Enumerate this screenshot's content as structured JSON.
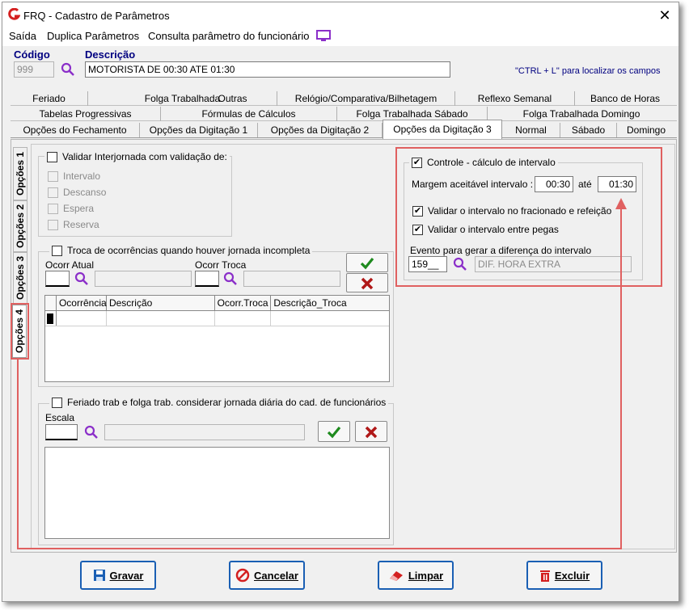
{
  "window": {
    "title": "FRQ - Cadastro de Parâmetros",
    "close": "✕"
  },
  "menu": [
    "Saída",
    "Duplica Parâmetros",
    "Consulta parâmetro do funcionário"
  ],
  "header": {
    "codigo_label": "Código",
    "codigo_value": "999",
    "descricao_label": "Descrição",
    "descricao_value": "MOTORISTA DE 00:30 ATE 01:30",
    "hint": "\"CTRL + L\" para localizar os campos"
  },
  "tabs_row1": [
    "Feriado",
    "Folga Trabalhada",
    "Outras",
    "Relógio/Comparativa/Bilhetagem",
    "Reflexo Semanal",
    "Banco de Horas"
  ],
  "tabs_row2": [
    "Tabelas Progressivas",
    "Fórmulas de Cálculos",
    "Folga Trabalhada Sábado",
    "Folga Trabalhada Domingo"
  ],
  "tabs_row3": [
    "Opções do Fechamento",
    "Opções da Digitação 1",
    "Opções da Digitação 2",
    "Opções da Digitação 3",
    "Normal",
    "Sábado",
    "Domingo"
  ],
  "side_tabs": [
    "Opções 1",
    "Opções 2",
    "Opções 3",
    "Opções 4"
  ],
  "interjornada": {
    "label": "Validar Interjornada com validação de:",
    "options": [
      "Intervalo",
      "Descanso",
      "Espera",
      "Reserva"
    ]
  },
  "troca": {
    "label": "Troca de ocorrências quando houver jornada incompleta",
    "ocorr_atual": "Ocorr Atual",
    "ocorr_troca": "Ocorr Troca",
    "columns": [
      "Ocorrência",
      "Descrição",
      "Ocorr.Troca",
      "Descrição_Troca"
    ]
  },
  "feriado": {
    "label": "Feriado trab e folga trab. considerar jornada diária do cad. de funcionários",
    "escala": "Escala"
  },
  "controle": {
    "label": "Controle - cálculo de intervalo",
    "margem_label": "Margem aceitável intervalo :",
    "from": "00:30",
    "ate": "até",
    "to": "01:30",
    "opt1": "Validar o intervalo no fracionado e refeição",
    "opt2": "Validar o intervalo entre pegas",
    "evento_label": "Evento para gerar a diferença do intervalo",
    "evento_code": "159__",
    "evento_desc": "DIF. HORA EXTRA"
  },
  "buttons": {
    "gravar": "Gravar",
    "cancelar": "Cancelar",
    "limpar": "Limpar",
    "excluir": "Excluir"
  },
  "colors": {
    "accent": "#1a5fb4",
    "highlight": "#e06060",
    "search": "#8b2fc9"
  }
}
